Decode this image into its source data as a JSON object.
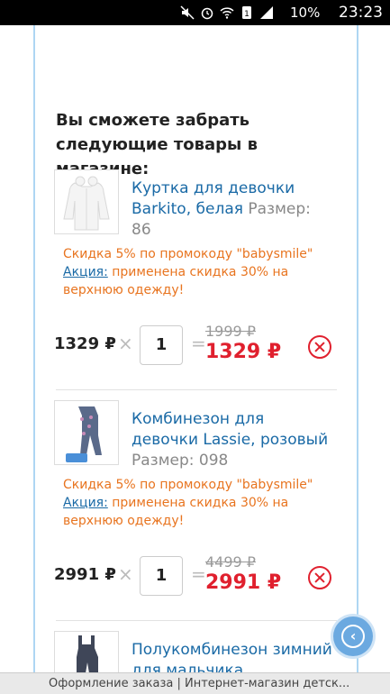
{
  "status_bar": {
    "battery": "10%",
    "time": "23:23",
    "icons": [
      "mute-icon",
      "alarm-icon",
      "wifi-icon",
      "sim-icon",
      "signal-icon",
      "battery-icon"
    ]
  },
  "heading": "Вы сможете забрать следующие товары в магазине:",
  "items": [
    {
      "title": "Куртка для девочки Barkito, белая",
      "size_label": "Размер: 86",
      "promo_line": "Скидка 5% по промокоду \"babysmile\"",
      "action_label": "Акция:",
      "action_text": "применена скидка 30% на верхнюю одежду!",
      "price": "1329 ₽",
      "quantity": "1",
      "old_price": "1999 ₽",
      "new_price": "1329 ₽"
    },
    {
      "title": "Комбинезон для девочки Lassie, розовый",
      "size_label": "Размер: 098",
      "promo_line": "Скидка 5% по промокоду \"babysmile\"",
      "action_label": "Акция:",
      "action_text": "применена скидка 30% на верхнюю одежду!",
      "price": "2991 ₽",
      "quantity": "1",
      "old_price": "4499 ₽",
      "new_price": "2991 ₽"
    },
    {
      "title": "Полукомбинезон зимний для мальчика"
    }
  ],
  "times_sign": "×",
  "equals_sign": "=",
  "back_button_icon": "‹",
  "page_tab_title": "Оформление заказа | Интернет-магазин детск..."
}
